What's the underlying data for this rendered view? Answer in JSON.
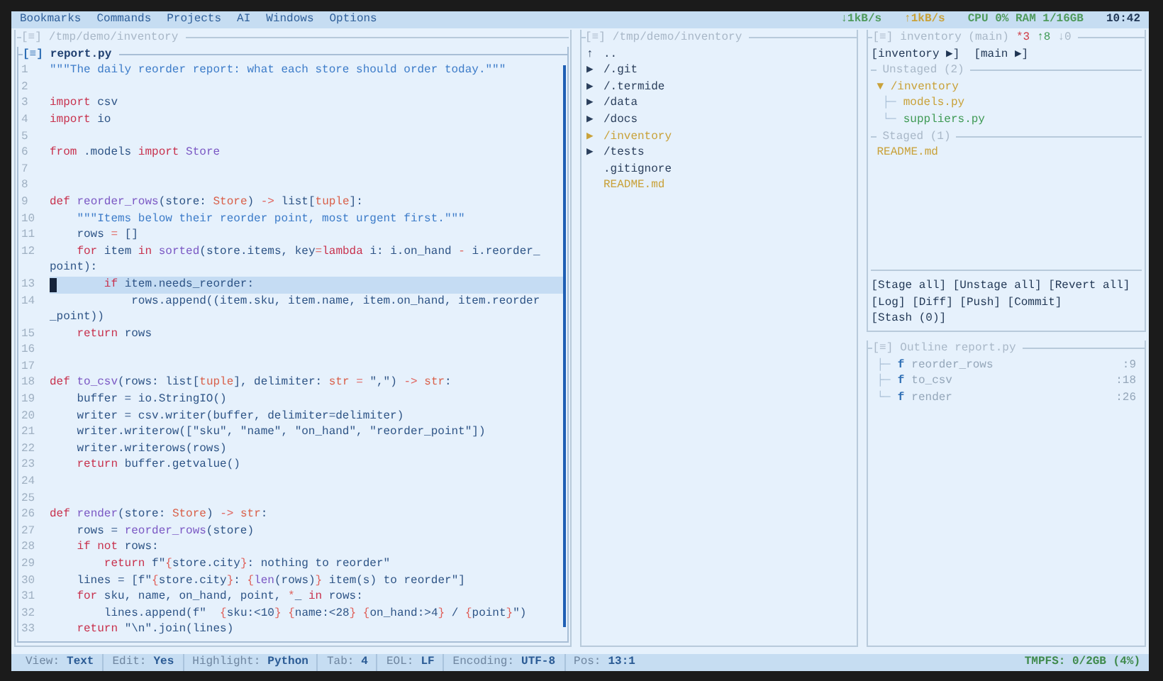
{
  "menu": [
    "Bookmarks",
    "Commands",
    "Projects",
    "AI",
    "Windows",
    "Options"
  ],
  "indicators": [
    {
      "text": "↓1kB/s",
      "color": "#4f9a5c"
    },
    {
      "text": "↑1kB/s",
      "color": "#c9a23a"
    },
    {
      "text": "CPU 0% RAM 1/16GB",
      "color": "#4f9a5c"
    },
    {
      "text": "10:42",
      "color": "#1f3553"
    }
  ],
  "workspace": {
    "glyph": "[≡]",
    "title": "/tmp/demo/inventory"
  },
  "editor": {
    "glyph": "[≡]",
    "title": "report.py",
    "lines": [
      {
        "n": "1",
        "selected": false,
        "rows": [
          [
            {
              "kind": "doc",
              "text": "\"\"\"The daily reorder report: what each store should order today.\"\"\""
            }
          ]
        ]
      },
      {
        "n": "2",
        "selected": false,
        "rows": [
          []
        ]
      },
      {
        "n": "3",
        "selected": false,
        "rows": [
          [
            {
              "kind": "kw",
              "text": "import"
            },
            {
              "kind": "txt",
              "text": " csv"
            }
          ]
        ]
      },
      {
        "n": "4",
        "selected": false,
        "rows": [
          [
            {
              "kind": "kw",
              "text": "import"
            },
            {
              "kind": "txt",
              "text": " io"
            }
          ]
        ]
      },
      {
        "n": "5",
        "selected": false,
        "rows": [
          []
        ]
      },
      {
        "n": "6",
        "selected": false,
        "rows": [
          [
            {
              "kind": "kw",
              "text": "from"
            },
            {
              "kind": "txt",
              "text": " .models "
            },
            {
              "kind": "kw",
              "text": "import"
            },
            {
              "kind": "txt",
              "text": " "
            },
            {
              "kind": "fn",
              "text": "Store"
            }
          ]
        ]
      },
      {
        "n": "7",
        "selected": false,
        "rows": [
          []
        ]
      },
      {
        "n": "8",
        "selected": false,
        "rows": [
          []
        ]
      },
      {
        "n": "9",
        "selected": false,
        "rows": [
          [
            {
              "kind": "kw",
              "text": "def"
            },
            {
              "kind": "txt",
              "text": " "
            },
            {
              "kind": "fn",
              "text": "reorder_rows"
            },
            {
              "kind": "txt",
              "text": "(store: "
            },
            {
              "kind": "type",
              "text": "Store"
            },
            {
              "kind": "txt",
              "text": ") "
            },
            {
              "kind": "op",
              "text": "->"
            },
            {
              "kind": "txt",
              "text": " list["
            },
            {
              "kind": "type",
              "text": "tuple"
            },
            {
              "kind": "txt",
              "text": "]:"
            }
          ]
        ]
      },
      {
        "n": "10",
        "selected": false,
        "rows": [
          [
            {
              "kind": "doc",
              "text": "    \"\"\"Items below their reorder point, most urgent first.\"\"\""
            }
          ]
        ]
      },
      {
        "n": "11",
        "selected": false,
        "rows": [
          [
            {
              "kind": "txt",
              "text": "    rows "
            },
            {
              "kind": "op",
              "text": "="
            },
            {
              "kind": "txt",
              "text": " []"
            }
          ]
        ]
      },
      {
        "n": "12",
        "selected": false,
        "rows": [
          [
            {
              "kind": "txt",
              "text": "    "
            },
            {
              "kind": "kw",
              "text": "for"
            },
            {
              "kind": "txt",
              "text": " item "
            },
            {
              "kind": "kw",
              "text": "in"
            },
            {
              "kind": "txt",
              "text": " "
            },
            {
              "kind": "fn",
              "text": "sorted"
            },
            {
              "kind": "txt",
              "text": "(store.items, key"
            },
            {
              "kind": "op",
              "text": "="
            },
            {
              "kind": "kw",
              "text": "lambda"
            },
            {
              "kind": "txt",
              "text": " i: i.on_hand "
            },
            {
              "kind": "op",
              "text": "-"
            },
            {
              "kind": "txt",
              "text": " i.reorder_"
            }
          ],
          [
            {
              "kind": "txt",
              "text": "point):"
            }
          ]
        ]
      },
      {
        "n": "13",
        "selected": true,
        "rows": [
          [
            {
              "kind": "txt",
              "text": "        "
            },
            {
              "kind": "kw",
              "text": "if"
            },
            {
              "kind": "txt",
              "text": " item.needs_reorder:"
            }
          ]
        ]
      },
      {
        "n": "14",
        "selected": false,
        "rows": [
          [
            {
              "kind": "txt",
              "text": "            rows.append((item.sku, item.name, item.on_hand, item.reorder"
            }
          ],
          [
            {
              "kind": "txt",
              "text": "_point))"
            }
          ]
        ]
      },
      {
        "n": "15",
        "selected": false,
        "rows": [
          [
            {
              "kind": "txt",
              "text": "    "
            },
            {
              "kind": "kw",
              "text": "return"
            },
            {
              "kind": "txt",
              "text": " rows"
            }
          ]
        ]
      },
      {
        "n": "16",
        "selected": false,
        "rows": [
          []
        ]
      },
      {
        "n": "17",
        "selected": false,
        "rows": [
          []
        ]
      },
      {
        "n": "18",
        "selected": false,
        "rows": [
          [
            {
              "kind": "kw",
              "text": "def"
            },
            {
              "kind": "txt",
              "text": " "
            },
            {
              "kind": "fn",
              "text": "to_csv"
            },
            {
              "kind": "txt",
              "text": "(rows: list["
            },
            {
              "kind": "type",
              "text": "tuple"
            },
            {
              "kind": "txt",
              "text": "], delimiter: "
            },
            {
              "kind": "type",
              "text": "str"
            },
            {
              "kind": "txt",
              "text": " "
            },
            {
              "kind": "op",
              "text": "="
            },
            {
              "kind": "txt",
              "text": " \",\") "
            },
            {
              "kind": "op",
              "text": "->"
            },
            {
              "kind": "txt",
              "text": " "
            },
            {
              "kind": "type",
              "text": "str"
            },
            {
              "kind": "txt",
              "text": ":"
            }
          ]
        ]
      },
      {
        "n": "19",
        "selected": false,
        "rows": [
          [
            {
              "kind": "txt",
              "text": "    buffer = io.StringIO()"
            }
          ]
        ]
      },
      {
        "n": "20",
        "selected": false,
        "rows": [
          [
            {
              "kind": "txt",
              "text": "    writer = csv.writer(buffer, delimiter=delimiter)"
            }
          ]
        ]
      },
      {
        "n": "21",
        "selected": false,
        "rows": [
          [
            {
              "kind": "txt",
              "text": "    writer.writerow([\"sku\", \"name\", \"on_hand\", \"reorder_point\"])"
            }
          ]
        ]
      },
      {
        "n": "22",
        "selected": false,
        "rows": [
          [
            {
              "kind": "txt",
              "text": "    writer.writerows(rows)"
            }
          ]
        ]
      },
      {
        "n": "23",
        "selected": false,
        "rows": [
          [
            {
              "kind": "txt",
              "text": "    "
            },
            {
              "kind": "kw",
              "text": "return"
            },
            {
              "kind": "txt",
              "text": " buffer.getvalue()"
            }
          ]
        ]
      },
      {
        "n": "24",
        "selected": false,
        "rows": [
          []
        ]
      },
      {
        "n": "25",
        "selected": false,
        "rows": [
          []
        ]
      },
      {
        "n": "26",
        "selected": false,
        "rows": [
          [
            {
              "kind": "kw",
              "text": "def"
            },
            {
              "kind": "txt",
              "text": " "
            },
            {
              "kind": "fn",
              "text": "render"
            },
            {
              "kind": "txt",
              "text": "(store: "
            },
            {
              "kind": "type",
              "text": "Store"
            },
            {
              "kind": "txt",
              "text": ") "
            },
            {
              "kind": "op",
              "text": "->"
            },
            {
              "kind": "txt",
              "text": " "
            },
            {
              "kind": "type",
              "text": "str"
            },
            {
              "kind": "txt",
              "text": ":"
            }
          ]
        ]
      },
      {
        "n": "27",
        "selected": false,
        "rows": [
          [
            {
              "kind": "txt",
              "text": "    rows = "
            },
            {
              "kind": "fn",
              "text": "reorder_rows"
            },
            {
              "kind": "txt",
              "text": "(store)"
            }
          ]
        ]
      },
      {
        "n": "28",
        "selected": false,
        "rows": [
          [
            {
              "kind": "txt",
              "text": "    "
            },
            {
              "kind": "kw",
              "text": "if"
            },
            {
              "kind": "txt",
              "text": " "
            },
            {
              "kind": "kw",
              "text": "not"
            },
            {
              "kind": "txt",
              "text": " rows:"
            }
          ]
        ]
      },
      {
        "n": "29",
        "selected": false,
        "rows": [
          [
            {
              "kind": "txt",
              "text": "        "
            },
            {
              "kind": "kw",
              "text": "return"
            },
            {
              "kind": "txt",
              "text": " f\""
            },
            {
              "kind": "op",
              "text": "{"
            },
            {
              "kind": "txt",
              "text": "store.city"
            },
            {
              "kind": "op",
              "text": "}"
            },
            {
              "kind": "txt",
              "text": ": nothing to reorder\""
            }
          ]
        ]
      },
      {
        "n": "30",
        "selected": false,
        "rows": [
          [
            {
              "kind": "txt",
              "text": "    lines = [f\""
            },
            {
              "kind": "op",
              "text": "{"
            },
            {
              "kind": "txt",
              "text": "store.city"
            },
            {
              "kind": "op",
              "text": "}"
            },
            {
              "kind": "txt",
              "text": ": "
            },
            {
              "kind": "op",
              "text": "{"
            },
            {
              "kind": "fn",
              "text": "len"
            },
            {
              "kind": "txt",
              "text": "(rows)"
            },
            {
              "kind": "op",
              "text": "}"
            },
            {
              "kind": "txt",
              "text": " item(s) to reorder\"]"
            }
          ]
        ]
      },
      {
        "n": "31",
        "selected": false,
        "rows": [
          [
            {
              "kind": "txt",
              "text": "    "
            },
            {
              "kind": "kw",
              "text": "for"
            },
            {
              "kind": "txt",
              "text": " sku, name, on_hand, point, "
            },
            {
              "kind": "op",
              "text": "*"
            },
            {
              "kind": "txt",
              "text": "_ "
            },
            {
              "kind": "kw",
              "text": "in"
            },
            {
              "kind": "txt",
              "text": " rows:"
            }
          ]
        ]
      },
      {
        "n": "32",
        "selected": false,
        "rows": [
          [
            {
              "kind": "txt",
              "text": "        lines.append(f\"  "
            },
            {
              "kind": "op",
              "text": "{"
            },
            {
              "kind": "txt",
              "text": "sku:<10"
            },
            {
              "kind": "op",
              "text": "}"
            },
            {
              "kind": "txt",
              "text": " "
            },
            {
              "kind": "op",
              "text": "{"
            },
            {
              "kind": "txt",
              "text": "name:<28"
            },
            {
              "kind": "op",
              "text": "}"
            },
            {
              "kind": "txt",
              "text": " "
            },
            {
              "kind": "op",
              "text": "{"
            },
            {
              "kind": "txt",
              "text": "on_hand:>4"
            },
            {
              "kind": "op",
              "text": "}"
            },
            {
              "kind": "txt",
              "text": " / "
            },
            {
              "kind": "op",
              "text": "{"
            },
            {
              "kind": "txt",
              "text": "point"
            },
            {
              "kind": "op",
              "text": "}"
            },
            {
              "kind": "txt",
              "text": "\")"
            }
          ]
        ]
      },
      {
        "n": "33",
        "selected": false,
        "rows": [
          [
            {
              "kind": "txt",
              "text": "    "
            },
            {
              "kind": "kw",
              "text": "return"
            },
            {
              "kind": "txt",
              "text": " \"\\n\".join(lines)"
            }
          ]
        ]
      }
    ]
  },
  "explorer": {
    "glyph": "[≡]",
    "title": "/tmp/demo/inventory",
    "items": [
      {
        "icon": "↑",
        "name": "..",
        "color": "#2b3f5c"
      },
      {
        "icon": "▶",
        "name": "/.git",
        "color": "#2b3f5c"
      },
      {
        "icon": "▶",
        "name": "/.termide",
        "color": "#2b3f5c"
      },
      {
        "icon": "▶",
        "name": "/data",
        "color": "#2b3f5c"
      },
      {
        "icon": "▶",
        "name": "/docs",
        "color": "#2b3f5c"
      },
      {
        "icon": "▶",
        "name": "/inventory",
        "color": "#c9a23a"
      },
      {
        "icon": "▶",
        "name": "/tests",
        "color": "#2b3f5c"
      },
      {
        "name": ".gitignore",
        "color": "#2b3f5c"
      },
      {
        "name": "README.md",
        "color": "#c9a23a"
      }
    ]
  },
  "git": {
    "glyph": "[≡]",
    "title": "inventory (main)",
    "counts": [
      {
        "text": "*3",
        "color": "#d0404a"
      },
      {
        "text": "↑8",
        "color": "#3f9a55"
      },
      {
        "text": "↓0",
        "color": "#a9b8c8"
      }
    ],
    "branches": [
      "[inventory ▶]",
      "[main ▶]"
    ],
    "sections": [
      {
        "title": "Unstaged (2)",
        "items": [
          {
            "icon": "▼",
            "name": "/inventory",
            "color": "#c9a23a",
            "children": [
              {
                "branch": "├─",
                "name": "models.py",
                "color": "#c9a23a"
              },
              {
                "branch": "└─",
                "name": "suppliers.py",
                "color": "#3f9a55"
              }
            ]
          }
        ]
      },
      {
        "title": "Staged (1)",
        "items": [
          {
            "name": "README.md",
            "color": "#c9a23a"
          }
        ]
      }
    ],
    "actions": [
      [
        "[Stage all]",
        "[Unstage all]",
        "[Revert all]"
      ],
      [
        "[Log]",
        "[Diff]",
        "[Push]",
        "[Commit]"
      ],
      [
        "[Stash (0)]"
      ]
    ]
  },
  "outline": {
    "glyph": "[≡]",
    "title": "Outline report.py",
    "items": [
      {
        "branch": "├─",
        "icon": "f",
        "name": "reorder_rows",
        "line": ":9"
      },
      {
        "branch": "├─",
        "icon": "f",
        "name": "to_csv",
        "line": ":18"
      },
      {
        "branch": "└─",
        "icon": "f",
        "name": "render",
        "line": ":26"
      }
    ]
  },
  "status": {
    "fields": [
      {
        "label": "View:",
        "value": "Text"
      },
      {
        "label": "Edit:",
        "value": "Yes"
      },
      {
        "label": "Highlight:",
        "value": "Python"
      },
      {
        "label": "Tab:",
        "value": "4"
      },
      {
        "label": "EOL:",
        "value": "LF"
      },
      {
        "label": "Encoding:",
        "value": "UTF-8"
      },
      {
        "label": "Pos:",
        "value": "13:1"
      }
    ],
    "disk": "TMPFS: 0/2GB (4%)"
  }
}
